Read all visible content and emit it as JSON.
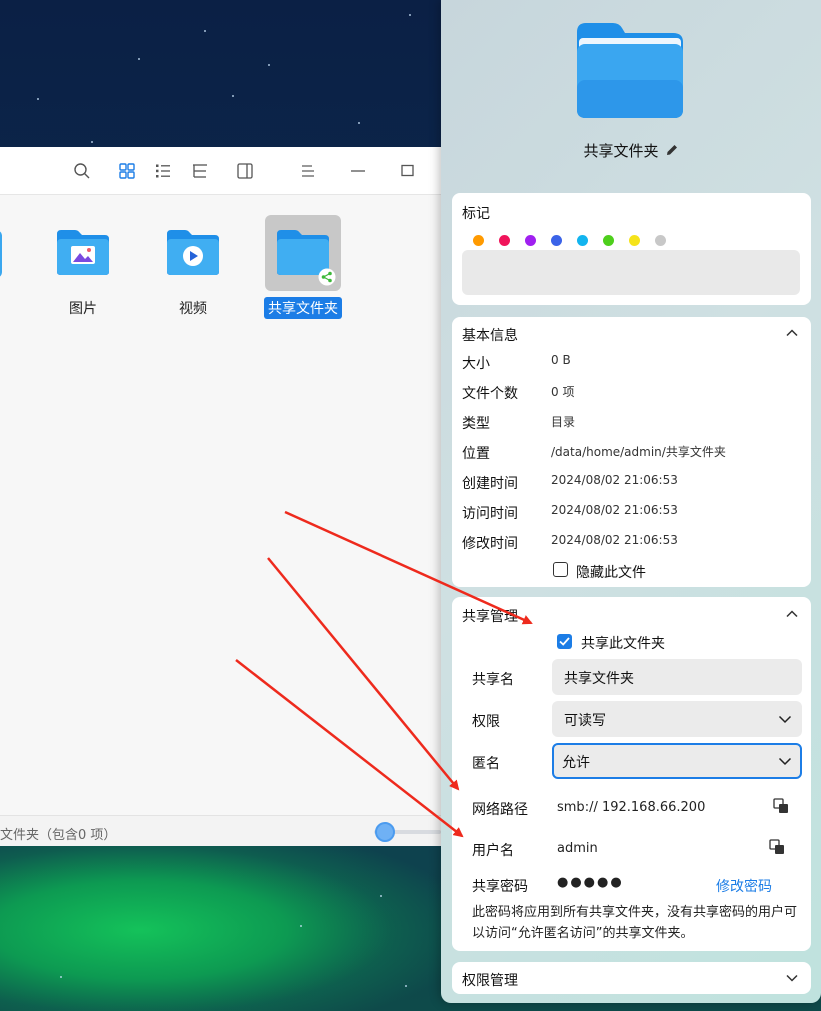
{
  "file_manager": {
    "items": [
      {
        "label": "图片",
        "icon": "pictures-folder-icon"
      },
      {
        "label": "视频",
        "icon": "videos-folder-icon"
      },
      {
        "label": "共享文件夹",
        "icon": "shared-folder-icon",
        "selected": true
      }
    ],
    "status": "文件夹（包含0 项）",
    "accent_color": "#1c7de6"
  },
  "properties": {
    "title": "共享文件夹",
    "tags": {
      "title": "标记",
      "colors": [
        "#ff9a00",
        "#f0145a",
        "#a020f0",
        "#3b63e8",
        "#12b4ef",
        "#4ecf1c",
        "#f5e31a",
        "#c8c8c8"
      ]
    },
    "basic_info": {
      "title": "基本信息",
      "rows": [
        {
          "key": "大小",
          "value": "0 B"
        },
        {
          "key": "文件个数",
          "value": "0 项"
        },
        {
          "key": "类型",
          "value": "目录"
        },
        {
          "key": "位置",
          "value": "/data/home/admin/共享文件夹"
        },
        {
          "key": "创建时间",
          "value": "2024/08/02 21:06:53"
        },
        {
          "key": "访问时间",
          "value": "2024/08/02 21:06:53"
        },
        {
          "key": "修改时间",
          "value": "2024/08/02 21:06:53"
        }
      ],
      "hide_file_label": "隐藏此文件"
    },
    "share": {
      "title": "共享管理",
      "share_checkbox_label": "共享此文件夹",
      "share_name_key": "共享名",
      "share_name_value": "共享文件夹",
      "permission_key": "权限",
      "permission_value": "可读写",
      "anonymous_key": "匿名",
      "anonymous_value": "允许",
      "network_path_key": "网络路径",
      "network_path_value": "smb://  192.168.66.200",
      "username_key": "用户名",
      "username_value": "admin",
      "password_key": "共享密码",
      "password_value": "●●●●●",
      "change_password_label": "修改密码",
      "note": "此密码将应用到所有共享文件夹，没有共享密码的用户可以访问“允许匿名访问”的共享文件夹。"
    },
    "permissions": {
      "title": "权限管理"
    }
  }
}
